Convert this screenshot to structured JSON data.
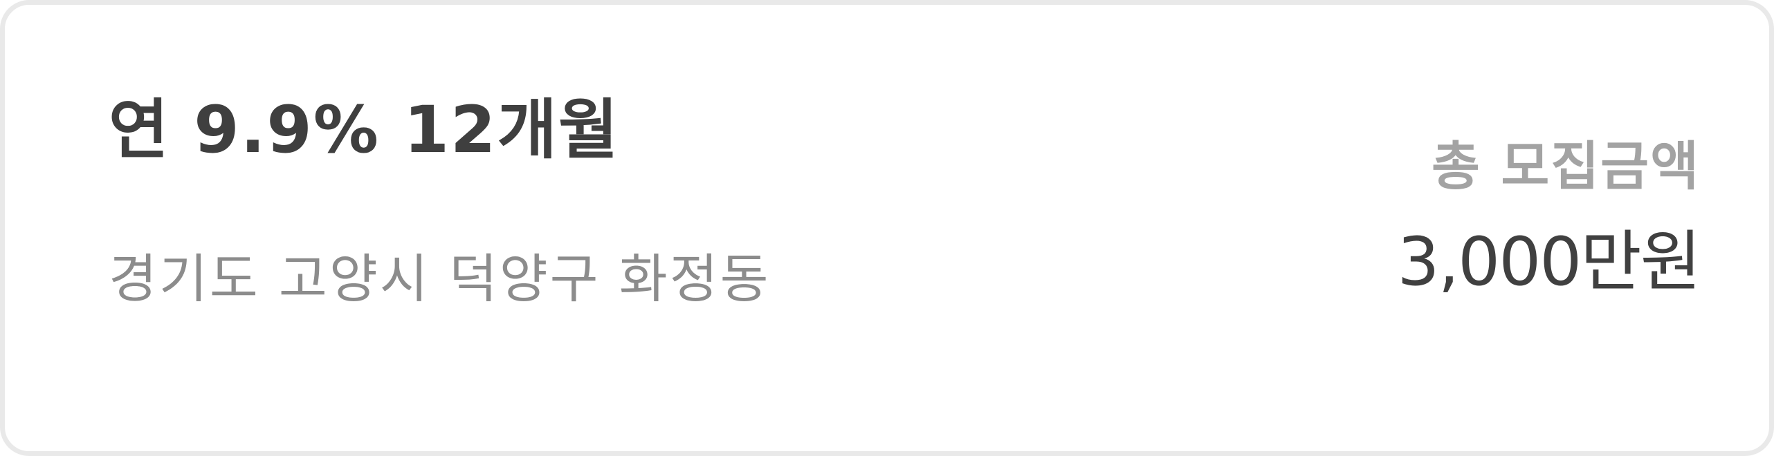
{
  "product": {
    "headline": "연 9.9% 12개월",
    "location": "경기도 고양시 덕양구 화정동"
  },
  "funding": {
    "total_label": "총 모집금액",
    "total_amount": "3,000만원"
  }
}
